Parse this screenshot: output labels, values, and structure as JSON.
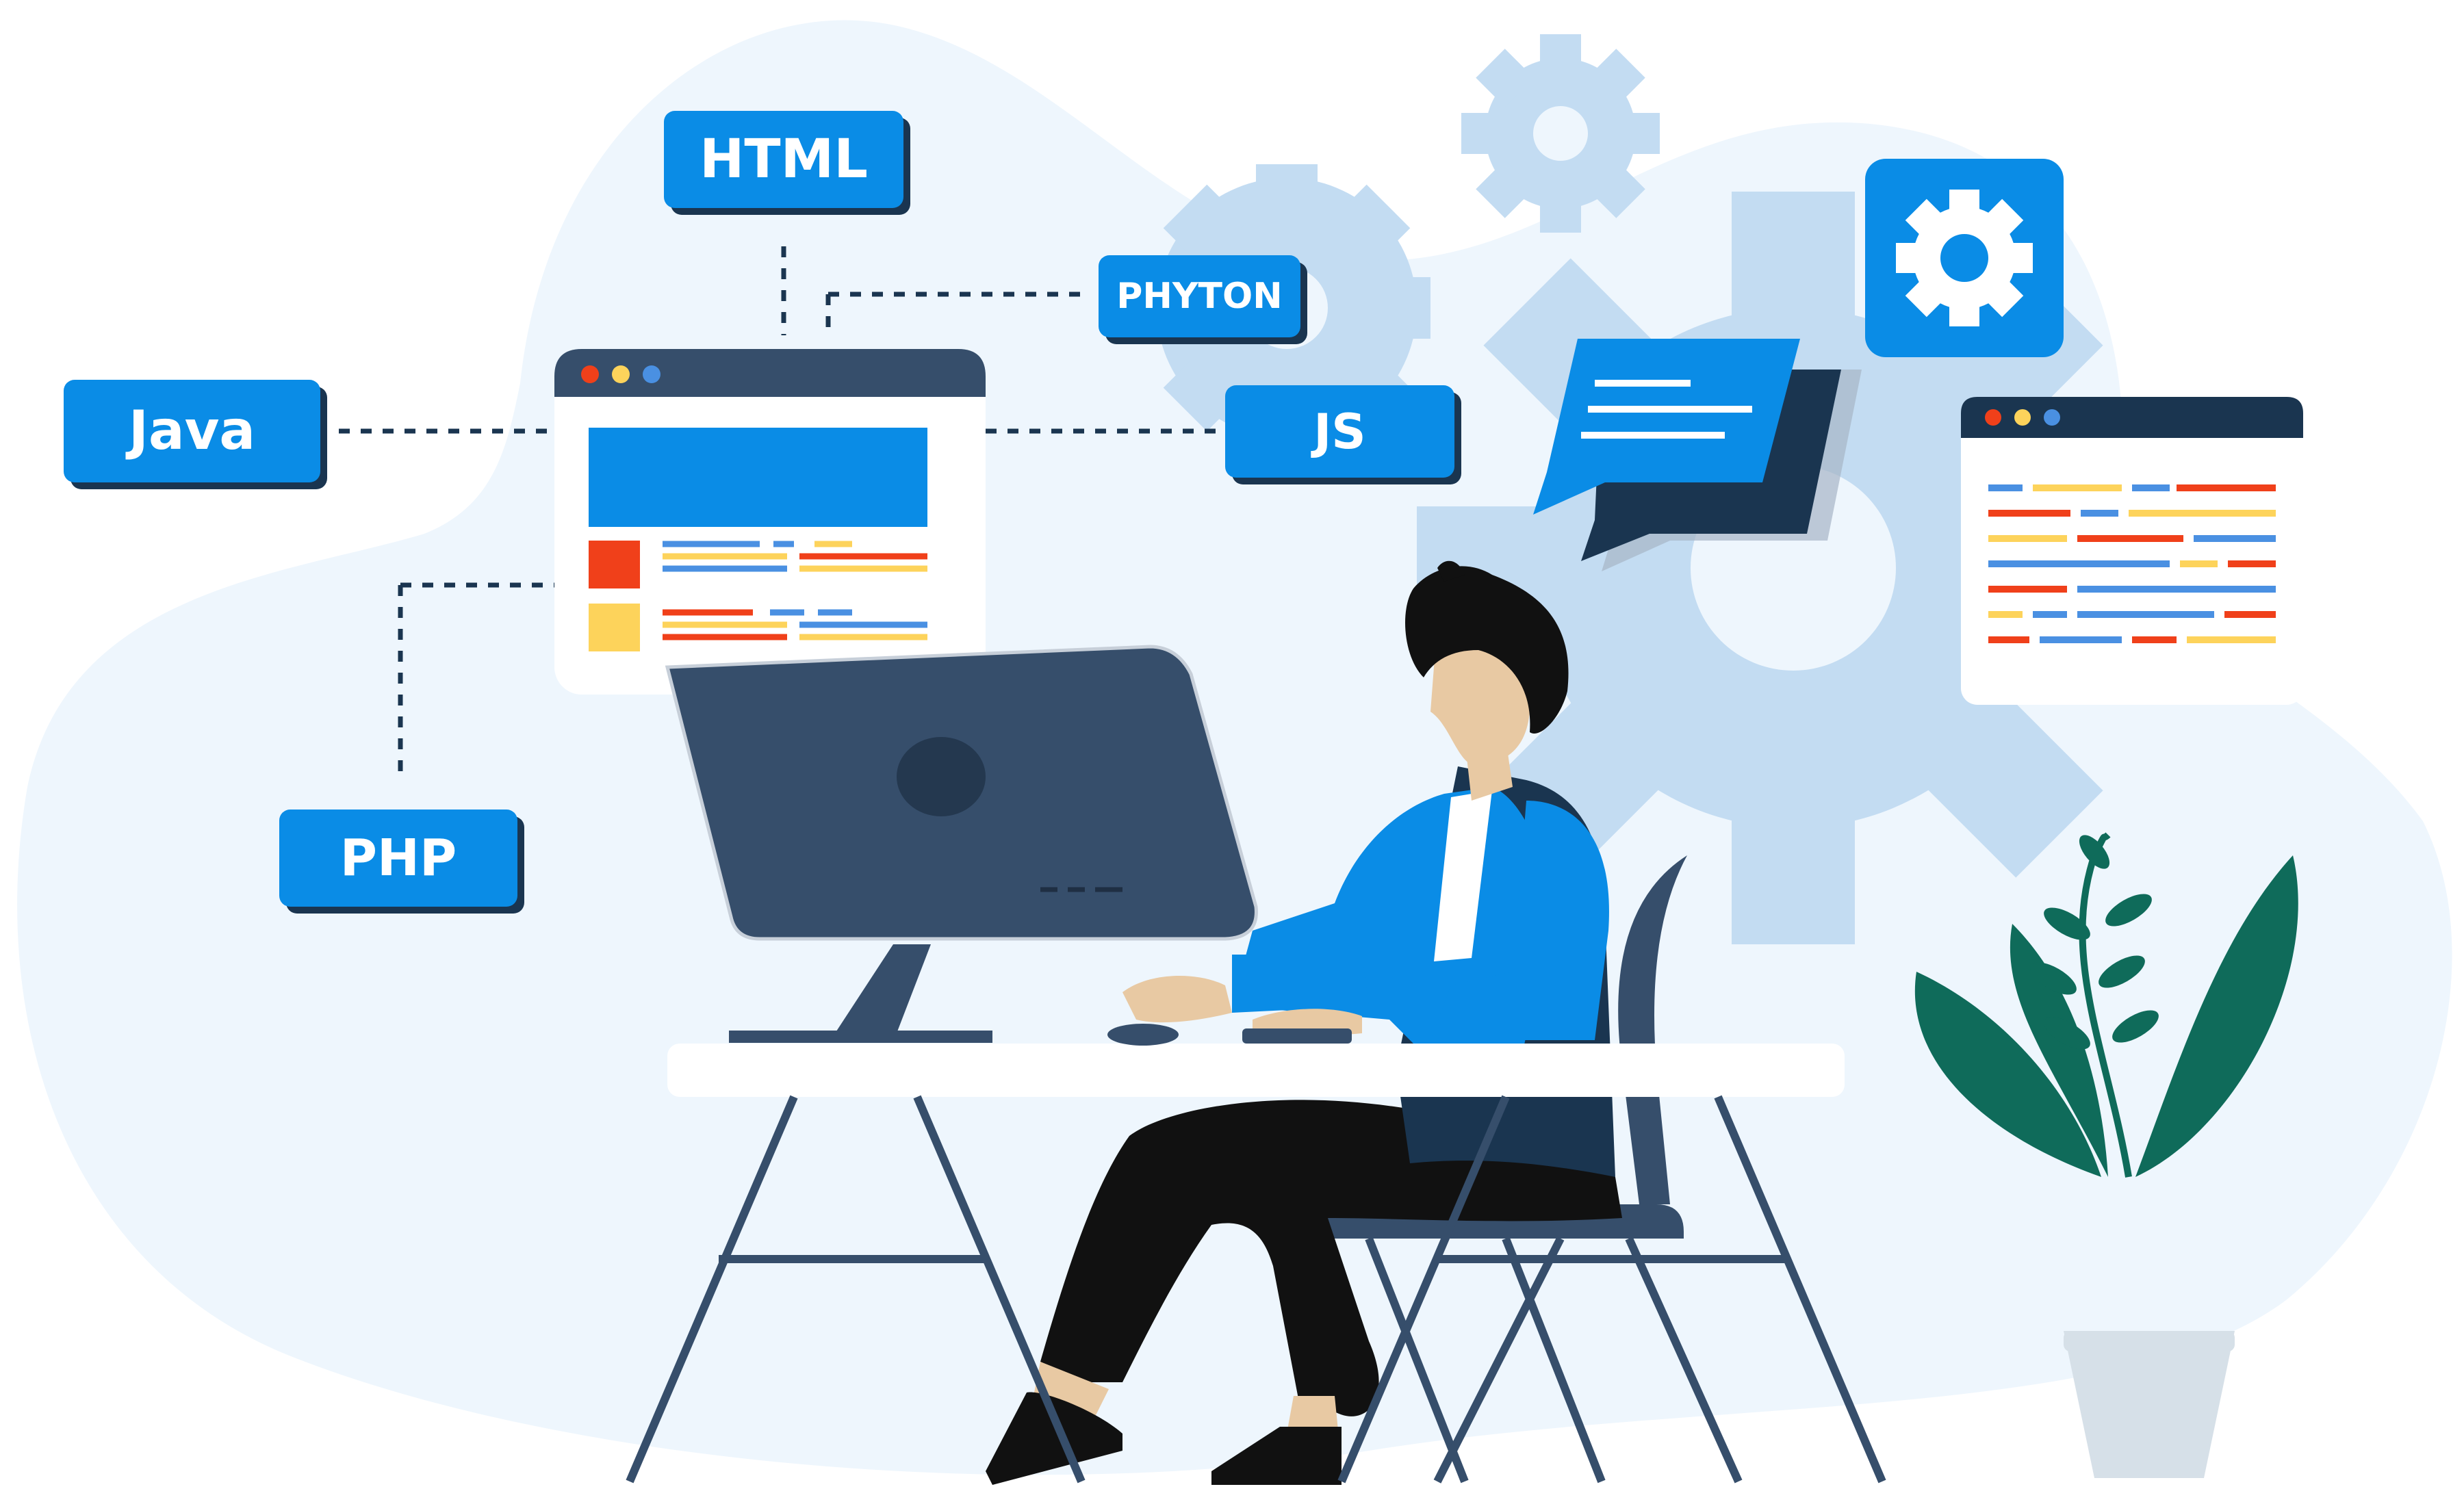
{
  "illustration": {
    "subject": "developer-at-computer",
    "palette": {
      "background": "#eef6fd",
      "accent_blue": "#0a8ce6",
      "gear": "#c3dcf2",
      "navy": "#364e6b",
      "dark_navy": "#1a3550",
      "red": "#f0401a",
      "yellow": "#fdd35b",
      "link_blue": "#4a90e2",
      "plant_green": "#0f6b5a"
    }
  },
  "tags": {
    "html": "HTML",
    "phyton": "PHYTON",
    "java": "Java",
    "js": "JS",
    "php": "PHP"
  },
  "windows": {
    "browser_left": {
      "dots": [
        "#f0401a",
        "#fdd35b",
        "#4a90e2"
      ]
    },
    "code_right": {
      "dots": [
        "#f0401a",
        "#fdd35b",
        "#4a90e2"
      ]
    }
  },
  "icons": [
    "gear-icon",
    "settings-gear-icon",
    "chat-bubble-icon",
    "plant-icon",
    "monitor-icon"
  ]
}
